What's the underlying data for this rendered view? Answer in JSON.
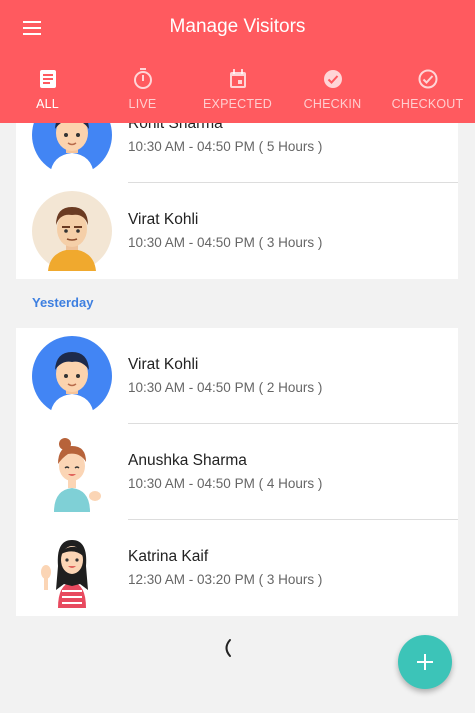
{
  "appbar": {
    "title": "Manage Visitors",
    "menu_icon": "menu-icon"
  },
  "tabs": [
    {
      "label": "ALL",
      "icon": "list-icon",
      "active": true
    },
    {
      "label": "LIVE",
      "icon": "timer-icon",
      "active": false
    },
    {
      "label": "EXPECTED",
      "icon": "calendar-icon",
      "active": false
    },
    {
      "label": "CHECKIN",
      "icon": "check-circle-icon",
      "active": false
    },
    {
      "label": "CHECKOUT",
      "icon": "check-circle-outline-icon",
      "active": false
    }
  ],
  "today": [
    {
      "name": "Rohit Sharma",
      "time": "10:30 AM - 04:50 PM ( 5 Hours )",
      "avatar": "boy-blue-avatar"
    },
    {
      "name": "Virat Kohli",
      "time": "10:30 AM - 04:50 PM ( 3 Hours )",
      "avatar": "man-beige-avatar"
    }
  ],
  "section_yesterday": "Yesterday",
  "yesterday": [
    {
      "name": "Virat Kohli",
      "time": "10:30 AM - 04:50 PM ( 2 Hours )",
      "avatar": "boy-blue-avatar"
    },
    {
      "name": "Anushka Sharma",
      "time": "10:30 AM - 04:50 PM ( 4 Hours )",
      "avatar": "girl-waving-avatar"
    },
    {
      "name": "Katrina Kaif",
      "time": "12:30 AM - 03:20 PM ( 3 Hours )",
      "avatar": "woman-waving-avatar"
    }
  ],
  "fab_icon": "add-icon",
  "colors": {
    "primary": "#ff5a5f",
    "accent": "#3cc4b8",
    "section": "#3d7fe0"
  }
}
